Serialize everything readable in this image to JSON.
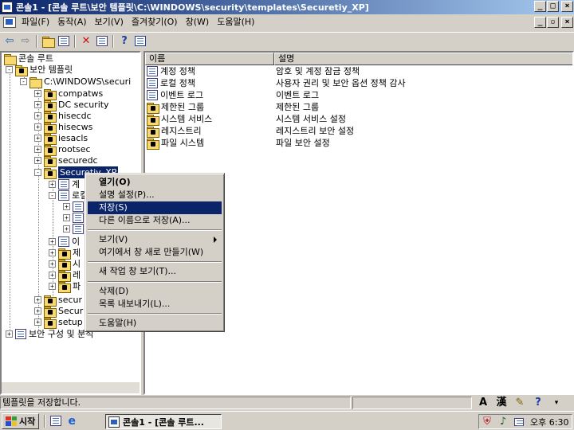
{
  "window": {
    "title": "콘솔1 - [콘솔 루트\\보안 템플릿\\C:\\WINDOWS\\security\\templates\\Securetiy_XP]",
    "controls": {
      "minimize": "_",
      "maximize": "□",
      "close": "×"
    }
  },
  "menu": {
    "items": [
      "파일(F)",
      "동작(A)",
      "보기(V)",
      "즐겨찾기(O)",
      "창(W)",
      "도움말(H)"
    ],
    "inner_controls": {
      "minimize": "_",
      "restore": "▫",
      "close": "×"
    }
  },
  "toolbar": {
    "buttons": [
      "back-icon",
      "forward-icon",
      "up-folder-icon",
      "show-tree-icon",
      "delete-icon",
      "properties-icon",
      "help-icon",
      "console-icon"
    ]
  },
  "tree": {
    "root": "콘솔 루트",
    "templates": "보안 템플릿",
    "path": "C:\\WINDOWS\\securi",
    "items": [
      "compatws",
      "DC security",
      "hisecdc",
      "hisecws",
      "iesacls",
      "rootsec",
      "securedc",
      "Securetiy_XP"
    ],
    "children_partial": [
      "계",
      "로컬",
      "이",
      "제",
      "시",
      "레",
      "파"
    ],
    "after": [
      "secur",
      "Secur",
      "setup"
    ],
    "analysis": "보안 구성 및 분석"
  },
  "list": {
    "columns": [
      "이름",
      "설명"
    ],
    "rows": [
      {
        "name": "계정 정책",
        "desc": "암호 및 계정 잠금 정책"
      },
      {
        "name": "로컬 정책",
        "desc": "사용자 권리 및 보안 옵션 정책 감사"
      },
      {
        "name": "이벤트 로그",
        "desc": "이벤트 로그"
      },
      {
        "name": "제한된 그룹",
        "desc": "제한된 그룹"
      },
      {
        "name": "시스템 서비스",
        "desc": "시스템 서비스 설정"
      },
      {
        "name": "레지스트리",
        "desc": "레지스트리 보안 설정"
      },
      {
        "name": "파일 시스템",
        "desc": "파일 보안 설정"
      }
    ]
  },
  "context_menu": {
    "items": [
      {
        "label": "열기(O)"
      },
      {
        "label": "설명 설정(P)..."
      },
      {
        "label": "저장(S)"
      },
      {
        "label": "다른 이름으로 저장(A)..."
      },
      {
        "label": "보기(V)"
      },
      {
        "label": "여기에서 창 새로 만들기(W)"
      },
      {
        "label": "새 작업 창 보기(T)..."
      },
      {
        "label": "삭제(D)"
      },
      {
        "label": "목록 내보내기(L)..."
      },
      {
        "label": "도움말(H)"
      }
    ]
  },
  "status": {
    "text": "템플릿을 저장합니다."
  },
  "ime": {
    "mode": "A",
    "hanja": "漢"
  },
  "taskbar": {
    "start": "시작",
    "task": "콘솔1 - [콘솔 루트...",
    "clock": "오후 6:30"
  }
}
